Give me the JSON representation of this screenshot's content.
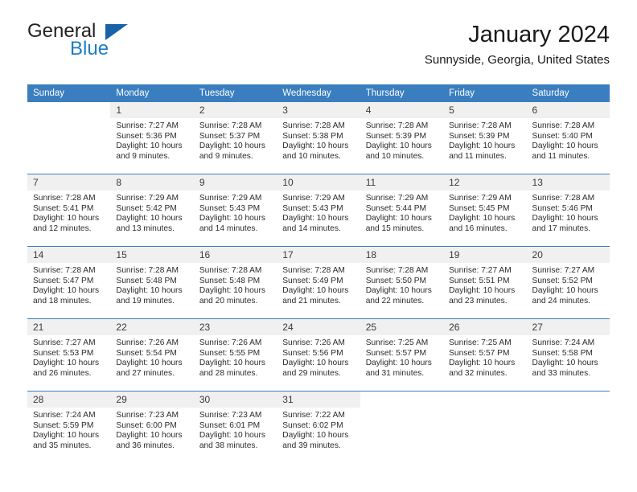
{
  "brand": {
    "name_top": "General",
    "name_bottom": "Blue",
    "accent_color": "#1863a8",
    "blue_text_color": "#1d7dc2"
  },
  "header": {
    "title": "January 2024",
    "subtitle": "Sunnyside, Georgia, United States"
  },
  "theme": {
    "header_row_bg": "#3a7ebf",
    "daynum_bg": "#f0f0f0",
    "text_color": "#2b2b2b"
  },
  "weekday_headers": [
    "Sunday",
    "Monday",
    "Tuesday",
    "Wednesday",
    "Thursday",
    "Friday",
    "Saturday"
  ],
  "labels": {
    "sunrise_prefix": "Sunrise:",
    "sunset_prefix": "Sunset:",
    "daylight_prefix": "Daylight:"
  },
  "weeks": [
    [
      {
        "day": "",
        "empty": true,
        "sunrise": "",
        "sunset": "",
        "daylight": ""
      },
      {
        "day": "1",
        "sunrise": "Sunrise: 7:27 AM",
        "sunset": "Sunset: 5:36 PM",
        "daylight": "Daylight: 10 hours and 9 minutes."
      },
      {
        "day": "2",
        "sunrise": "Sunrise: 7:28 AM",
        "sunset": "Sunset: 5:37 PM",
        "daylight": "Daylight: 10 hours and 9 minutes."
      },
      {
        "day": "3",
        "sunrise": "Sunrise: 7:28 AM",
        "sunset": "Sunset: 5:38 PM",
        "daylight": "Daylight: 10 hours and 10 minutes."
      },
      {
        "day": "4",
        "sunrise": "Sunrise: 7:28 AM",
        "sunset": "Sunset: 5:39 PM",
        "daylight": "Daylight: 10 hours and 10 minutes."
      },
      {
        "day": "5",
        "sunrise": "Sunrise: 7:28 AM",
        "sunset": "Sunset: 5:39 PM",
        "daylight": "Daylight: 10 hours and 11 minutes."
      },
      {
        "day": "6",
        "sunrise": "Sunrise: 7:28 AM",
        "sunset": "Sunset: 5:40 PM",
        "daylight": "Daylight: 10 hours and 11 minutes."
      }
    ],
    [
      {
        "day": "7",
        "sunrise": "Sunrise: 7:28 AM",
        "sunset": "Sunset: 5:41 PM",
        "daylight": "Daylight: 10 hours and 12 minutes."
      },
      {
        "day": "8",
        "sunrise": "Sunrise: 7:29 AM",
        "sunset": "Sunset: 5:42 PM",
        "daylight": "Daylight: 10 hours and 13 minutes."
      },
      {
        "day": "9",
        "sunrise": "Sunrise: 7:29 AM",
        "sunset": "Sunset: 5:43 PM",
        "daylight": "Daylight: 10 hours and 14 minutes."
      },
      {
        "day": "10",
        "sunrise": "Sunrise: 7:29 AM",
        "sunset": "Sunset: 5:43 PM",
        "daylight": "Daylight: 10 hours and 14 minutes."
      },
      {
        "day": "11",
        "sunrise": "Sunrise: 7:29 AM",
        "sunset": "Sunset: 5:44 PM",
        "daylight": "Daylight: 10 hours and 15 minutes."
      },
      {
        "day": "12",
        "sunrise": "Sunrise: 7:29 AM",
        "sunset": "Sunset: 5:45 PM",
        "daylight": "Daylight: 10 hours and 16 minutes."
      },
      {
        "day": "13",
        "sunrise": "Sunrise: 7:28 AM",
        "sunset": "Sunset: 5:46 PM",
        "daylight": "Daylight: 10 hours and 17 minutes."
      }
    ],
    [
      {
        "day": "14",
        "sunrise": "Sunrise: 7:28 AM",
        "sunset": "Sunset: 5:47 PM",
        "daylight": "Daylight: 10 hours and 18 minutes."
      },
      {
        "day": "15",
        "sunrise": "Sunrise: 7:28 AM",
        "sunset": "Sunset: 5:48 PM",
        "daylight": "Daylight: 10 hours and 19 minutes."
      },
      {
        "day": "16",
        "sunrise": "Sunrise: 7:28 AM",
        "sunset": "Sunset: 5:48 PM",
        "daylight": "Daylight: 10 hours and 20 minutes."
      },
      {
        "day": "17",
        "sunrise": "Sunrise: 7:28 AM",
        "sunset": "Sunset: 5:49 PM",
        "daylight": "Daylight: 10 hours and 21 minutes."
      },
      {
        "day": "18",
        "sunrise": "Sunrise: 7:28 AM",
        "sunset": "Sunset: 5:50 PM",
        "daylight": "Daylight: 10 hours and 22 minutes."
      },
      {
        "day": "19",
        "sunrise": "Sunrise: 7:27 AM",
        "sunset": "Sunset: 5:51 PM",
        "daylight": "Daylight: 10 hours and 23 minutes."
      },
      {
        "day": "20",
        "sunrise": "Sunrise: 7:27 AM",
        "sunset": "Sunset: 5:52 PM",
        "daylight": "Daylight: 10 hours and 24 minutes."
      }
    ],
    [
      {
        "day": "21",
        "sunrise": "Sunrise: 7:27 AM",
        "sunset": "Sunset: 5:53 PM",
        "daylight": "Daylight: 10 hours and 26 minutes."
      },
      {
        "day": "22",
        "sunrise": "Sunrise: 7:26 AM",
        "sunset": "Sunset: 5:54 PM",
        "daylight": "Daylight: 10 hours and 27 minutes."
      },
      {
        "day": "23",
        "sunrise": "Sunrise: 7:26 AM",
        "sunset": "Sunset: 5:55 PM",
        "daylight": "Daylight: 10 hours and 28 minutes."
      },
      {
        "day": "24",
        "sunrise": "Sunrise: 7:26 AM",
        "sunset": "Sunset: 5:56 PM",
        "daylight": "Daylight: 10 hours and 29 minutes."
      },
      {
        "day": "25",
        "sunrise": "Sunrise: 7:25 AM",
        "sunset": "Sunset: 5:57 PM",
        "daylight": "Daylight: 10 hours and 31 minutes."
      },
      {
        "day": "26",
        "sunrise": "Sunrise: 7:25 AM",
        "sunset": "Sunset: 5:57 PM",
        "daylight": "Daylight: 10 hours and 32 minutes."
      },
      {
        "day": "27",
        "sunrise": "Sunrise: 7:24 AM",
        "sunset": "Sunset: 5:58 PM",
        "daylight": "Daylight: 10 hours and 33 minutes."
      }
    ],
    [
      {
        "day": "28",
        "sunrise": "Sunrise: 7:24 AM",
        "sunset": "Sunset: 5:59 PM",
        "daylight": "Daylight: 10 hours and 35 minutes."
      },
      {
        "day": "29",
        "sunrise": "Sunrise: 7:23 AM",
        "sunset": "Sunset: 6:00 PM",
        "daylight": "Daylight: 10 hours and 36 minutes."
      },
      {
        "day": "30",
        "sunrise": "Sunrise: 7:23 AM",
        "sunset": "Sunset: 6:01 PM",
        "daylight": "Daylight: 10 hours and 38 minutes."
      },
      {
        "day": "31",
        "sunrise": "Sunrise: 7:22 AM",
        "sunset": "Sunset: 6:02 PM",
        "daylight": "Daylight: 10 hours and 39 minutes."
      },
      {
        "day": "",
        "empty": true,
        "sunrise": "",
        "sunset": "",
        "daylight": ""
      },
      {
        "day": "",
        "empty": true,
        "sunrise": "",
        "sunset": "",
        "daylight": ""
      },
      {
        "day": "",
        "empty": true,
        "sunrise": "",
        "sunset": "",
        "daylight": ""
      }
    ]
  ]
}
